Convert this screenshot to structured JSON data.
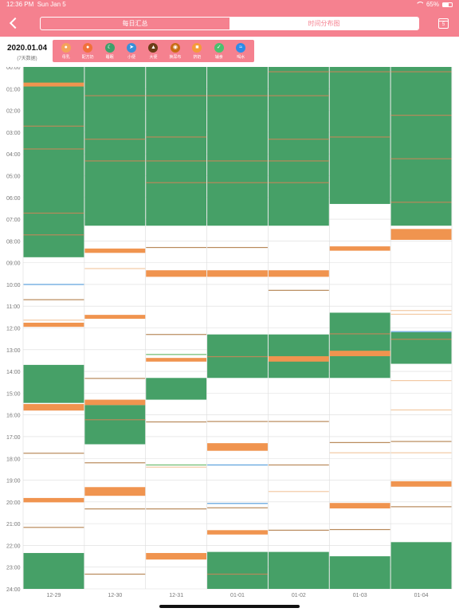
{
  "status": {
    "time": "12:36 PM",
    "date": "Sun Jan 5",
    "battery": "65%"
  },
  "nav": {
    "tabs": [
      {
        "label": "每日汇总",
        "active": false
      },
      {
        "label": "时间分布图",
        "active": true
      }
    ],
    "calendar_day": "5"
  },
  "period": {
    "date": "2020.01.04",
    "note": "(7天数据)"
  },
  "legend": [
    {
      "label": "母乳",
      "icon": "breastfeeding-icon",
      "color": "#f4a25a"
    },
    {
      "label": "配方奶",
      "icon": "bottle-icon",
      "color": "#f1703b"
    },
    {
      "label": "睡眠",
      "icon": "moon-icon",
      "color": "#3ea06a"
    },
    {
      "label": "小便",
      "icon": "pee-icon",
      "color": "#3a8fd8"
    },
    {
      "label": "大便",
      "icon": "poop-icon",
      "color": "#6b3c16"
    },
    {
      "label": "换尿布",
      "icon": "diaper-icon",
      "color": "#c86b14"
    },
    {
      "label": "挤奶",
      "icon": "pump-icon",
      "color": "#f59a3a"
    },
    {
      "label": "辅食",
      "icon": "food-icon",
      "color": "#4cc06e"
    },
    {
      "label": "喝水",
      "icon": "water-icon",
      "color": "#2e8be8"
    }
  ],
  "chart_data": {
    "type": "timeline",
    "x_categories": [
      "12-29",
      "12-30",
      "12-31",
      "01-01",
      "01-02",
      "01-03",
      "01-04"
    ],
    "y_ticks": [
      "00:00",
      "01:00",
      "02:00",
      "03:00",
      "04:00",
      "05:00",
      "06:00",
      "07:00",
      "08:00",
      "09:00",
      "10:00",
      "11:00",
      "12:00",
      "13:00",
      "14:00",
      "15:00",
      "16:00",
      "17:00",
      "18:00",
      "19:00",
      "20:00",
      "21:00",
      "22:00",
      "23:00",
      "24:00"
    ],
    "y_range": [
      0,
      24
    ],
    "colors": {
      "sleep": "#46a067",
      "feed": "#f0944f",
      "line": "#b8895a",
      "thin": "#d99a5e",
      "blue": "#5aa0dc",
      "pale": "#f3c9a3",
      "green": "#6dbb6e"
    },
    "days": [
      {
        "events": [
          [
            "sleep",
            0,
            8.75
          ],
          [
            "feed",
            0.72,
            0.9
          ],
          [
            "line",
            2.7,
            2.75
          ],
          [
            "line",
            3.75,
            3.8
          ],
          [
            "line",
            6.7,
            6.75
          ],
          [
            "line",
            7.7,
            7.75
          ],
          [
            "blue",
            9.98,
            10.02
          ],
          [
            "line",
            10.68,
            10.72
          ],
          [
            "pale",
            11.62,
            11.66
          ],
          [
            "feed",
            11.76,
            11.95
          ],
          [
            "sleep",
            13.7,
            15.45
          ],
          [
            "feed",
            15.5,
            15.8
          ],
          [
            "line",
            17.74,
            17.78
          ],
          [
            "feed",
            19.82,
            20.02
          ],
          [
            "line",
            21.15,
            21.19
          ],
          [
            "sleep",
            22.35,
            24
          ]
        ]
      },
      {
        "events": [
          [
            "sleep",
            0,
            7.3
          ],
          [
            "line",
            1.3,
            1.35
          ],
          [
            "line",
            3.3,
            3.35
          ],
          [
            "line",
            4.3,
            4.35
          ],
          [
            "feed",
            8.35,
            8.55
          ],
          [
            "pale",
            9.25,
            9.3
          ],
          [
            "feed",
            11.4,
            11.58
          ],
          [
            "line",
            14.3,
            14.35
          ],
          [
            "feed",
            15.3,
            15.55
          ],
          [
            "sleep",
            15.55,
            17.35
          ],
          [
            "line",
            16.2,
            16.25
          ],
          [
            "line",
            18.18,
            18.23
          ],
          [
            "feed",
            19.32,
            19.72
          ],
          [
            "line",
            20.3,
            20.35
          ],
          [
            "line",
            23.3,
            23.35
          ]
        ]
      },
      {
        "events": [
          [
            "sleep",
            0,
            7.3
          ],
          [
            "line",
            1.3,
            1.35
          ],
          [
            "line",
            3.2,
            3.25
          ],
          [
            "line",
            4.3,
            4.35
          ],
          [
            "line",
            5.3,
            5.35
          ],
          [
            "line",
            8.28,
            8.32
          ],
          [
            "feed",
            9.35,
            9.65
          ],
          [
            "line",
            12.28,
            12.32
          ],
          [
            "green",
            13.2,
            13.24
          ],
          [
            "feed",
            13.38,
            13.55
          ],
          [
            "sleep",
            14.3,
            15.3
          ],
          [
            "line",
            16.3,
            16.35
          ],
          [
            "green",
            18.28,
            18.32
          ],
          [
            "pale",
            18.38,
            18.42
          ],
          [
            "line",
            20.3,
            20.35
          ],
          [
            "feed",
            22.35,
            22.65
          ]
        ]
      },
      {
        "events": [
          [
            "sleep",
            0,
            7.3
          ],
          [
            "line",
            1.3,
            1.35
          ],
          [
            "line",
            4.3,
            4.35
          ],
          [
            "line",
            5.3,
            5.35
          ],
          [
            "line",
            8.28,
            8.32
          ],
          [
            "feed",
            9.35,
            9.65
          ],
          [
            "sleep",
            12.3,
            14.3
          ],
          [
            "line",
            13.3,
            13.35
          ],
          [
            "line",
            16.28,
            16.32
          ],
          [
            "feed",
            17.3,
            17.65
          ],
          [
            "blue",
            18.28,
            18.32
          ],
          [
            "blue",
            20.05,
            20.09
          ],
          [
            "line",
            20.25,
            20.29
          ],
          [
            "feed",
            21.3,
            21.5
          ],
          [
            "sleep",
            22.3,
            24
          ],
          [
            "line",
            23.3,
            23.35
          ]
        ]
      },
      {
        "events": [
          [
            "sleep",
            0,
            7.3
          ],
          [
            "line",
            0.2,
            0.25
          ],
          [
            "line",
            1.3,
            1.35
          ],
          [
            "line",
            3.3,
            3.35
          ],
          [
            "line",
            4.3,
            4.35
          ],
          [
            "line",
            5.3,
            5.35
          ],
          [
            "feed",
            9.35,
            9.65
          ],
          [
            "line",
            10.25,
            10.29
          ],
          [
            "sleep",
            12.3,
            14.3
          ],
          [
            "feed",
            13.3,
            13.55
          ],
          [
            "line",
            16.28,
            16.32
          ],
          [
            "line",
            18.28,
            18.32
          ],
          [
            "pale",
            19.5,
            19.54
          ],
          [
            "line",
            21.28,
            21.32
          ],
          [
            "sleep",
            22.3,
            24
          ]
        ]
      },
      {
        "events": [
          [
            "sleep",
            0,
            6.3
          ],
          [
            "line",
            0.2,
            0.25
          ],
          [
            "line",
            3.2,
            3.25
          ],
          [
            "feed",
            8.25,
            8.45
          ],
          [
            "sleep",
            11.3,
            14.3
          ],
          [
            "feed",
            13.05,
            13.3
          ],
          [
            "line",
            12.25,
            12.29
          ],
          [
            "line",
            17.25,
            17.29
          ],
          [
            "pale",
            17.72,
            17.76
          ],
          [
            "feed",
            20.05,
            20.3
          ],
          [
            "line",
            21.25,
            21.29
          ],
          [
            "sleep",
            22.5,
            24
          ]
        ]
      },
      {
        "events": [
          [
            "sleep",
            0,
            7.3
          ],
          [
            "line",
            0.2,
            0.25
          ],
          [
            "line",
            2.2,
            2.25
          ],
          [
            "line",
            4.2,
            4.25
          ],
          [
            "line",
            6.2,
            6.25
          ],
          [
            "feed",
            7.45,
            7.95
          ],
          [
            "pale",
            11.18,
            11.22
          ],
          [
            "pale",
            11.35,
            11.39
          ],
          [
            "blue",
            12.15,
            12.2
          ],
          [
            "sleep",
            12.2,
            13.65
          ],
          [
            "line",
            12.5,
            12.55
          ],
          [
            "pale",
            14.4,
            14.44
          ],
          [
            "pale",
            15.75,
            15.79
          ],
          [
            "line",
            17.2,
            17.24
          ],
          [
            "pale",
            17.72,
            17.76
          ],
          [
            "feed",
            19.05,
            19.3
          ],
          [
            "line",
            20.2,
            20.24
          ],
          [
            "sleep",
            21.85,
            24
          ]
        ]
      }
    ]
  }
}
